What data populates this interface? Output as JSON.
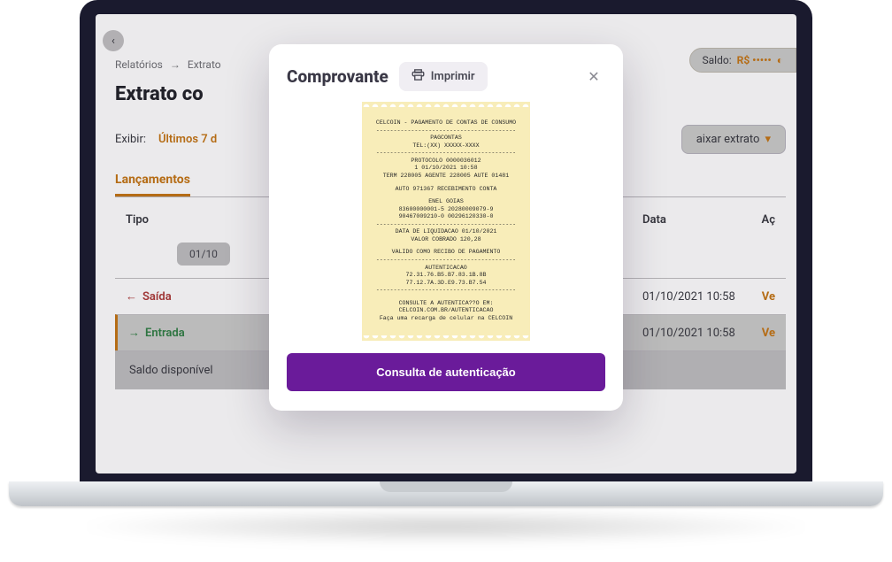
{
  "header": {
    "saldo_label": "Saldo:",
    "saldo_amount": "R$ •••••"
  },
  "breadcrumb": {
    "a": "Relatórios",
    "b": "Extrato"
  },
  "page_title": "Extrato co",
  "filter": {
    "label": "Exibir:",
    "value": "Últimos 7 d",
    "download": "aixar extrato"
  },
  "tab": "Lançamentos",
  "table": {
    "col_type": "Tipo",
    "col_date": "Data",
    "col_action": "Aç",
    "date_chip": "01/10",
    "rows": [
      {
        "type": "Saída",
        "kind": "saida",
        "date": "01/10/2021 10:58",
        "action": "Ve"
      },
      {
        "type": "Entrada",
        "kind": "entrada",
        "date": "01/10/2021 10:58",
        "action": "Ve"
      }
    ],
    "saldo_row": "Saldo disponível"
  },
  "modal": {
    "title": "Comprovante",
    "print": "Imprimir",
    "auth_button": "Consulta de autenticação"
  },
  "receipt": {
    "l1": "CELCOIN - PAGAMENTO DE CONTAS DE CONSUMO",
    "d": "----------------------------------------",
    "l2": "PAGCONTAS",
    "l3": "TEL:(XX) XXXXX-XXXX",
    "l4": "PROTOCOLO 0000036012",
    "l5": "1 01/10/2021 10:58",
    "l6": "TERM 228005 AGENTE 228005 AUTE 01481",
    "l7": "AUTO 971367 RECEBIMENTO CONTA",
    "l8": "ENEL GOIAS",
    "l9": "83600000001-5 20280009079-9",
    "l10": "90467009210-0 00296120330-0",
    "l11": "DATA DE LIQUIDACAO 01/10/2021",
    "l12": "VALOR COBRADO 120,28",
    "l13": "VALIDO COMO RECIBO DE PAGAMENTO",
    "l14": "AUTENTICACAO",
    "l15": "72.31.76.B5.B7.83.1B.8B",
    "l16": "77.12.7A.3D.E9.73.B7.54",
    "l17": "CONSULTE A AUTENTICA??O EM:",
    "l18": "CELCOIN.COM.BR/AUTENTICACAO",
    "l19": "Faça uma recarga de celular na CELCOIN"
  }
}
